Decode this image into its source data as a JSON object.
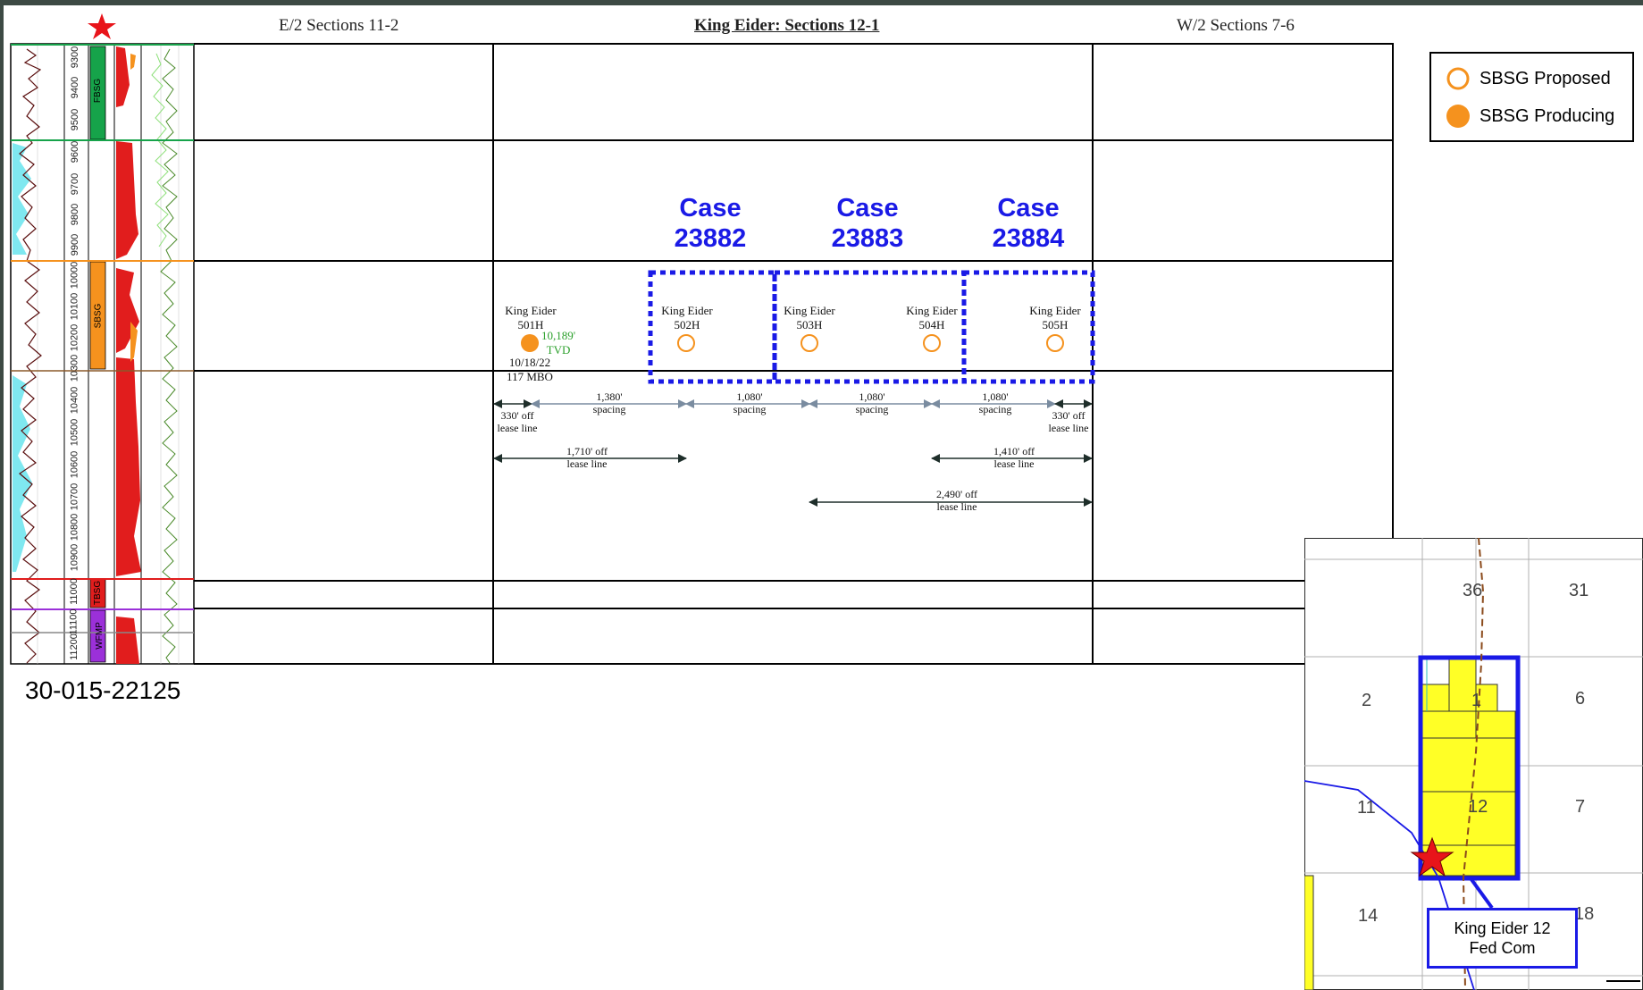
{
  "headers": {
    "left": "E/2 Sections 11-2",
    "center": "King Eider: Sections 12-1",
    "right": "W/2 Sections 7-6"
  },
  "legend": {
    "proposed": "SBSG Proposed",
    "producing": "SBSG Producing"
  },
  "api_number": "30-015-22125",
  "log_tracks": {
    "depths": [
      "9300",
      "9400",
      "9500",
      "9600",
      "9700",
      "9800",
      "9900",
      "10000",
      "10100",
      "10200",
      "10300",
      "10400",
      "10500",
      "10600",
      "10700",
      "10800",
      "10900",
      "11000",
      "11100",
      "11200"
    ],
    "formations": [
      "FBSG",
      "SBSG",
      "TBSG",
      "WFMP"
    ]
  },
  "cases": [
    {
      "line1": "Case",
      "line2": "23882"
    },
    {
      "line1": "Case",
      "line2": "23883"
    },
    {
      "line1": "Case",
      "line2": "23884"
    }
  ],
  "wells": [
    {
      "name": "King Eider",
      "number": "501H",
      "status": "producing"
    },
    {
      "name": "King Eider",
      "number": "502H",
      "status": "proposed"
    },
    {
      "name": "King Eider",
      "number": "503H",
      "status": "proposed"
    },
    {
      "name": "King Eider",
      "number": "504H",
      "status": "proposed"
    },
    {
      "name": "King Eider",
      "number": "505H",
      "status": "proposed"
    }
  ],
  "well_501": {
    "tvd_value": "10,189'",
    "tvd_unit": "TVD",
    "date": "10/18/22",
    "volume": "117 MBO"
  },
  "dimensions": {
    "off330_left": {
      "l1": "330' off",
      "l2": "lease line"
    },
    "spacing1": {
      "l1": "1,380'",
      "l2": "spacing"
    },
    "spacing2": {
      "l1": "1,080'",
      "l2": "spacing"
    },
    "spacing3": {
      "l1": "1,080'",
      "l2": "spacing"
    },
    "spacing4": {
      "l1": "1,080'",
      "l2": "spacing"
    },
    "off330_right": {
      "l1": "330' off",
      "l2": "lease line"
    },
    "off1710": {
      "l1": "1,710' off",
      "l2": "lease line"
    },
    "off1410": {
      "l1": "1,410' off",
      "l2": "lease line"
    },
    "off2490": {
      "l1": "2,490' off",
      "l2": "lease line"
    }
  },
  "map": {
    "sections": [
      "36",
      "31",
      "2",
      "1",
      "6",
      "11",
      "12",
      "7",
      "14",
      "18"
    ],
    "label_line1": "King Eider 12",
    "label_line2": "Fed Com"
  },
  "colors": {
    "case_blue": "#1a1ae6",
    "orange": "#f5921e",
    "star_red": "#e8141a",
    "fbsg": "#16a34a",
    "sbsg": "#f5921e",
    "tbsg": "#e11d1d",
    "wfmp": "#9b30d9",
    "lease_yellow": "#ffff26"
  }
}
